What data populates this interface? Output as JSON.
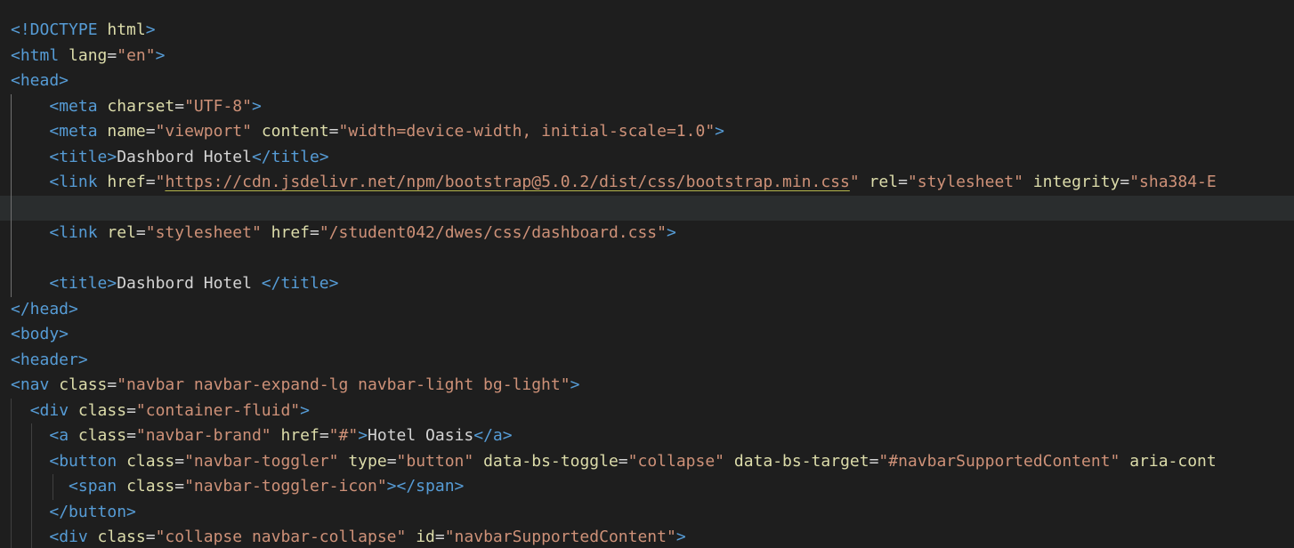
{
  "editor": {
    "lines": [
      {
        "indent": 0,
        "segments": [
          {
            "k": "t",
            "v": "<!DOCTYPE "
          },
          {
            "k": "a",
            "v": "html"
          },
          {
            "k": "t",
            "v": ">"
          }
        ]
      },
      {
        "indent": 0,
        "segments": [
          {
            "k": "t",
            "v": "<html "
          },
          {
            "k": "a",
            "v": "lang"
          },
          {
            "k": "eq",
            "v": "="
          },
          {
            "k": "av",
            "v": "\"en\""
          },
          {
            "k": "t",
            "v": ">"
          }
        ]
      },
      {
        "indent": 0,
        "segments": [
          {
            "k": "t",
            "v": "<head>"
          }
        ]
      },
      {
        "indent": 1,
        "segments": [
          {
            "k": "t",
            "v": "<meta "
          },
          {
            "k": "a",
            "v": "charset"
          },
          {
            "k": "eq",
            "v": "="
          },
          {
            "k": "av",
            "v": "\"UTF-8\""
          },
          {
            "k": "t",
            "v": ">"
          }
        ]
      },
      {
        "indent": 1,
        "segments": [
          {
            "k": "t",
            "v": "<meta "
          },
          {
            "k": "a",
            "v": "name"
          },
          {
            "k": "eq",
            "v": "="
          },
          {
            "k": "av",
            "v": "\"viewport\""
          },
          {
            "k": "tx",
            "v": " "
          },
          {
            "k": "a",
            "v": "content"
          },
          {
            "k": "eq",
            "v": "="
          },
          {
            "k": "av",
            "v": "\"width=device-width, initial-scale=1.0\""
          },
          {
            "k": "t",
            "v": ">"
          }
        ]
      },
      {
        "indent": 1,
        "segments": [
          {
            "k": "t",
            "v": "<title>"
          },
          {
            "k": "tx",
            "v": "Dashbord Hotel"
          },
          {
            "k": "t",
            "v": "</title>"
          }
        ]
      },
      {
        "indent": 1,
        "segments": [
          {
            "k": "t",
            "v": "<link "
          },
          {
            "k": "a",
            "v": "href"
          },
          {
            "k": "eq",
            "v": "="
          },
          {
            "k": "av",
            "v": "\""
          },
          {
            "k": "url",
            "v": "https://cdn.jsdelivr.net/npm/bootstrap@5.0.2/dist/css/bootstrap.min.css"
          },
          {
            "k": "av",
            "v": "\""
          },
          {
            "k": "tx",
            "v": " "
          },
          {
            "k": "a",
            "v": "rel"
          },
          {
            "k": "eq",
            "v": "="
          },
          {
            "k": "av",
            "v": "\"stylesheet\""
          },
          {
            "k": "tx",
            "v": " "
          },
          {
            "k": "a",
            "v": "integrity"
          },
          {
            "k": "eq",
            "v": "="
          },
          {
            "k": "av",
            "v": "\"sha384-E"
          }
        ]
      },
      {
        "indent": 1,
        "current": true,
        "segments": []
      },
      {
        "indent": 1,
        "segments": [
          {
            "k": "t",
            "v": "<link "
          },
          {
            "k": "a",
            "v": "rel"
          },
          {
            "k": "eq",
            "v": "="
          },
          {
            "k": "av",
            "v": "\"stylesheet\""
          },
          {
            "k": "tx",
            "v": " "
          },
          {
            "k": "a",
            "v": "href"
          },
          {
            "k": "eq",
            "v": "="
          },
          {
            "k": "av",
            "v": "\"/student042/dwes/css/dashboard.css\""
          },
          {
            "k": "t",
            "v": ">"
          }
        ]
      },
      {
        "indent": 1,
        "segments": []
      },
      {
        "indent": 1,
        "segments": [
          {
            "k": "t",
            "v": "<title>"
          },
          {
            "k": "tx",
            "v": "Dashbord Hotel "
          },
          {
            "k": "t",
            "v": "</title>"
          }
        ]
      },
      {
        "indent": 0,
        "segments": [
          {
            "k": "t",
            "v": "</head>"
          }
        ]
      },
      {
        "indent": 0,
        "segments": [
          {
            "k": "t",
            "v": "<body>"
          }
        ]
      },
      {
        "indent": 0,
        "segments": [
          {
            "k": "t",
            "v": "<header>"
          }
        ]
      },
      {
        "indent": 0,
        "segments": [
          {
            "k": "t",
            "v": "<nav "
          },
          {
            "k": "a",
            "v": "class"
          },
          {
            "k": "eq",
            "v": "="
          },
          {
            "k": "av",
            "v": "\"navbar navbar-expand-lg navbar-light bg-light\""
          },
          {
            "k": "t",
            "v": ">"
          }
        ]
      },
      {
        "indent": 0,
        "guides": [
          1
        ],
        "segments": [
          {
            "k": "tx",
            "v": "  "
          },
          {
            "k": "t",
            "v": "<div "
          },
          {
            "k": "a",
            "v": "class"
          },
          {
            "k": "eq",
            "v": "="
          },
          {
            "k": "av",
            "v": "\"container-fluid\""
          },
          {
            "k": "t",
            "v": ">"
          }
        ]
      },
      {
        "indent": 0,
        "guides": [
          1,
          2
        ],
        "segments": [
          {
            "k": "tx",
            "v": "    "
          },
          {
            "k": "t",
            "v": "<a "
          },
          {
            "k": "a",
            "v": "class"
          },
          {
            "k": "eq",
            "v": "="
          },
          {
            "k": "av",
            "v": "\"navbar-brand\""
          },
          {
            "k": "tx",
            "v": " "
          },
          {
            "k": "a",
            "v": "href"
          },
          {
            "k": "eq",
            "v": "="
          },
          {
            "k": "av",
            "v": "\"#\""
          },
          {
            "k": "t",
            "v": ">"
          },
          {
            "k": "tx",
            "v": "Hotel Oasis"
          },
          {
            "k": "t",
            "v": "</a>"
          }
        ]
      },
      {
        "indent": 0,
        "guides": [
          1,
          2
        ],
        "segments": [
          {
            "k": "tx",
            "v": "    "
          },
          {
            "k": "t",
            "v": "<button "
          },
          {
            "k": "a",
            "v": "class"
          },
          {
            "k": "eq",
            "v": "="
          },
          {
            "k": "av",
            "v": "\"navbar-toggler\""
          },
          {
            "k": "tx",
            "v": " "
          },
          {
            "k": "a",
            "v": "type"
          },
          {
            "k": "eq",
            "v": "="
          },
          {
            "k": "av",
            "v": "\"button\""
          },
          {
            "k": "tx",
            "v": " "
          },
          {
            "k": "a",
            "v": "data-bs-toggle"
          },
          {
            "k": "eq",
            "v": "="
          },
          {
            "k": "av",
            "v": "\"collapse\""
          },
          {
            "k": "tx",
            "v": " "
          },
          {
            "k": "a",
            "v": "data-bs-target"
          },
          {
            "k": "eq",
            "v": "="
          },
          {
            "k": "av",
            "v": "\"#navbarSupportedContent\""
          },
          {
            "k": "tx",
            "v": " "
          },
          {
            "k": "a",
            "v": "aria-cont"
          }
        ]
      },
      {
        "indent": 0,
        "guides": [
          1,
          2,
          3
        ],
        "segments": [
          {
            "k": "tx",
            "v": "      "
          },
          {
            "k": "t",
            "v": "<span "
          },
          {
            "k": "a",
            "v": "class"
          },
          {
            "k": "eq",
            "v": "="
          },
          {
            "k": "av",
            "v": "\"navbar-toggler-icon\""
          },
          {
            "k": "t",
            "v": "></span>"
          }
        ]
      },
      {
        "indent": 0,
        "guides": [
          1,
          2
        ],
        "segments": [
          {
            "k": "tx",
            "v": "    "
          },
          {
            "k": "t",
            "v": "</button>"
          }
        ]
      },
      {
        "indent": 0,
        "guides": [
          1,
          2
        ],
        "segments": [
          {
            "k": "tx",
            "v": "    "
          },
          {
            "k": "t",
            "v": "<div "
          },
          {
            "k": "a",
            "v": "class"
          },
          {
            "k": "eq",
            "v": "="
          },
          {
            "k": "av",
            "v": "\"collapse navbar-collapse\""
          },
          {
            "k": "tx",
            "v": " "
          },
          {
            "k": "a",
            "v": "id"
          },
          {
            "k": "eq",
            "v": "="
          },
          {
            "k": "av",
            "v": "\"navbarSupportedContent\""
          },
          {
            "k": "t",
            "v": ">"
          }
        ]
      }
    ]
  }
}
